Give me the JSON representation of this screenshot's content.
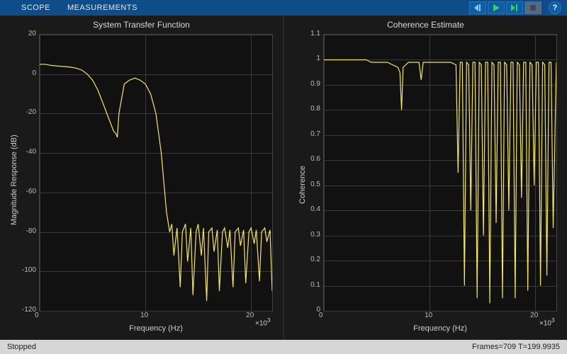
{
  "toolbar": {
    "tabs": [
      "SCOPE",
      "MEASUREMENTS"
    ],
    "help_label": "?"
  },
  "status": {
    "state": "Stopped",
    "info": "Frames=709  T=199.9935"
  },
  "chart_data": [
    {
      "type": "line",
      "title": "System Transfer Function",
      "xlabel": "Frequency (Hz)",
      "ylabel": "Magnitude Response (dB)",
      "x_exponent": "×10",
      "x_exp_sup": "3",
      "xlim": [
        0,
        22000
      ],
      "ylim": [
        -120,
        20
      ],
      "xticks": [
        0,
        10,
        20
      ],
      "yticks": [
        -120,
        -100,
        -80,
        -60,
        -40,
        -20,
        0,
        20
      ],
      "x": [
        0,
        500,
        1000,
        1500,
        2000,
        2500,
        3000,
        3500,
        4000,
        4500,
        5000,
        5500,
        6000,
        6500,
        7000,
        7200,
        7350,
        7500,
        8000,
        8500,
        9000,
        9500,
        10000,
        10500,
        11000,
        11500,
        12000,
        12300,
        12500,
        12700,
        13000,
        13300,
        13500,
        13800,
        14000,
        14300,
        14500,
        14800,
        15000,
        15300,
        15500,
        15800,
        16000,
        16300,
        16500,
        16800,
        17000,
        17300,
        17500,
        17800,
        18000,
        18300,
        18500,
        18800,
        19000,
        19300,
        19500,
        19800,
        20000,
        20300,
        20500,
        20800,
        21000,
        21300,
        21500,
        21800,
        22000
      ],
      "y": [
        5,
        5,
        4.5,
        4.2,
        4,
        3.8,
        3.5,
        3,
        2,
        0,
        -3,
        -8,
        -15,
        -22,
        -29,
        -30,
        -32,
        -20,
        -5,
        -3,
        -2,
        -3,
        -5,
        -10,
        -20,
        -40,
        -70,
        -80,
        -76,
        -92,
        -78,
        -108,
        -80,
        -76,
        -95,
        -78,
        -112,
        -80,
        -76,
        -92,
        -78,
        -115,
        -80,
        -78,
        -90,
        -79,
        -110,
        -80,
        -78,
        -88,
        -79,
        -108,
        -80,
        -78,
        -87,
        -79,
        -106,
        -80,
        -78,
        -86,
        -79,
        -105,
        -80,
        -78,
        -85,
        -79,
        -110
      ]
    },
    {
      "type": "line",
      "title": "Coherence Estimate",
      "xlabel": "Frequency (Hz)",
      "ylabel": "Coherence",
      "x_exponent": "×10",
      "x_exp_sup": "3",
      "xlim": [
        0,
        22000
      ],
      "ylim": [
        0,
        1.1
      ],
      "xticks": [
        0,
        10,
        20
      ],
      "yticks": [
        0,
        0.1,
        0.2,
        0.3,
        0.4,
        0.5,
        0.6,
        0.7,
        0.8,
        0.9,
        1,
        1.1
      ],
      "x": [
        0,
        500,
        1000,
        1500,
        2000,
        2500,
        3000,
        3500,
        4000,
        4500,
        5000,
        5500,
        6000,
        6500,
        7000,
        7200,
        7350,
        7500,
        8000,
        8500,
        9000,
        9200,
        9400,
        9600,
        10000,
        10500,
        11000,
        11500,
        12000,
        12500,
        12700,
        12900,
        13100,
        13300,
        13500,
        13700,
        13900,
        14100,
        14300,
        14500,
        14700,
        14900,
        15100,
        15300,
        15500,
        15700,
        15900,
        16100,
        16300,
        16500,
        16700,
        16900,
        17100,
        17300,
        17500,
        17700,
        17900,
        18100,
        18300,
        18500,
        18700,
        18900,
        19100,
        19300,
        19500,
        19700,
        19900,
        20100,
        20300,
        20500,
        20700,
        20900,
        21100,
        21300,
        21500,
        21700,
        22000
      ],
      "y": [
        1,
        1,
        1,
        1,
        1,
        1,
        1,
        1,
        1,
        0.99,
        0.99,
        0.99,
        0.99,
        0.98,
        0.97,
        0.95,
        0.8,
        0.97,
        0.99,
        0.99,
        0.99,
        0.92,
        0.99,
        0.99,
        0.99,
        0.99,
        0.99,
        0.99,
        0.99,
        0.98,
        0.55,
        0.99,
        0.99,
        0.1,
        0.99,
        0.98,
        0.4,
        0.99,
        0.99,
        0.05,
        0.99,
        0.98,
        0.3,
        0.99,
        0.99,
        0.03,
        0.99,
        0.98,
        0.35,
        0.99,
        0.99,
        0.05,
        0.99,
        0.98,
        0.4,
        0.99,
        0.99,
        0.05,
        0.99,
        0.98,
        0.45,
        0.99,
        0.99,
        0.08,
        0.99,
        0.98,
        0.5,
        0.99,
        0.99,
        0.1,
        0.99,
        0.98,
        0.14,
        0.99,
        0.99,
        0.33,
        0.99
      ]
    }
  ]
}
